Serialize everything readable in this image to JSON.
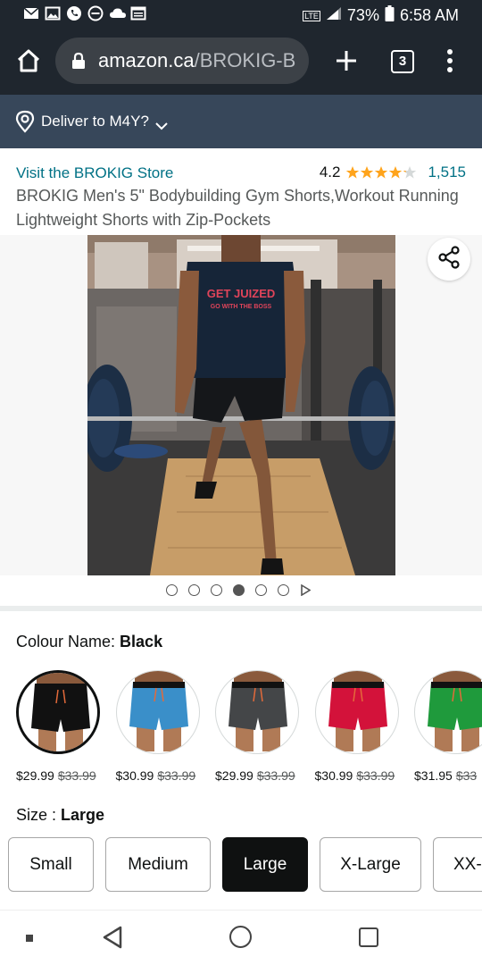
{
  "status_bar": {
    "lte": "LTE",
    "battery": "73%",
    "time": "6:58 AM"
  },
  "browser": {
    "url_domain": "amazon.ca",
    "url_path": "/BROKIG-B",
    "tab_count": "3"
  },
  "deliver": {
    "label": "Deliver to M4Y?"
  },
  "product": {
    "store_link": "Visit the BROKIG Store",
    "rating": "4.2",
    "rating_stars": 4.2,
    "review_count": "1,515",
    "title": "BROKIG Men's 5\" Bodybuilding Gym Shorts,Workout Running Lightweight Shorts with Zip-Pockets",
    "image_shirt_text": "GET JUIZED",
    "image_shirt_subtext": "GO WITH THE BOSS"
  },
  "carousel": {
    "dot_count": 6,
    "active_index": 3
  },
  "colour": {
    "label": "Colour Name: ",
    "selected": "Black",
    "swatches": [
      {
        "color": "#111111",
        "price": "$29.99",
        "old_price": "$33.99"
      },
      {
        "color": "#3a8fc9",
        "price": "$30.99",
        "old_price": "$33.99"
      },
      {
        "color": "#444648",
        "price": "$29.99",
        "old_price": "$33.99"
      },
      {
        "color": "#d3123a",
        "price": "$30.99",
        "old_price": "$33.99"
      },
      {
        "color": "#1f9a3c",
        "price": "$31.95",
        "old_price": "$33"
      }
    ]
  },
  "size": {
    "label": "Size : ",
    "selected": "Large",
    "options": [
      "Small",
      "Medium",
      "Large",
      "X-Large",
      "XX-"
    ]
  },
  "colors": {
    "amazon_link": "#007185",
    "star": "#ffa41c",
    "deliver_bg": "#37475a",
    "chrome_bg": "#1f262e"
  }
}
